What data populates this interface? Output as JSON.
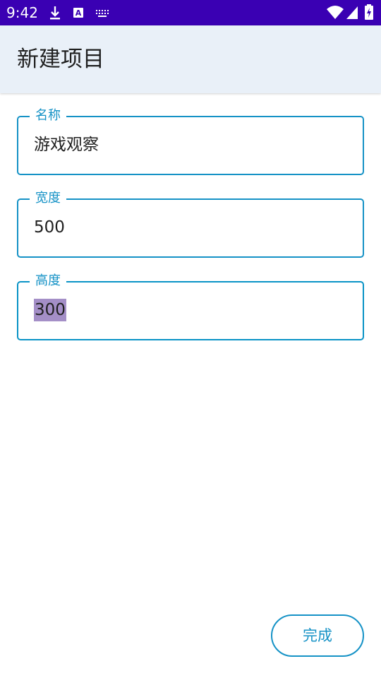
{
  "status_bar": {
    "time": "9:42",
    "left_icons": [
      "download-icon",
      "text-a-icon",
      "keyboard-icon"
    ],
    "right_icons": [
      "wifi-icon",
      "signal-icon",
      "battery-charging-icon"
    ]
  },
  "app_bar": {
    "title": "新建项目"
  },
  "form": {
    "fields": [
      {
        "label": "名称",
        "value": "游戏观察"
      },
      {
        "label": "宽度",
        "value": "500"
      },
      {
        "label": "高度",
        "value": "300"
      }
    ]
  },
  "actions": {
    "done_label": "完成"
  },
  "colors": {
    "status_bar": "#3a00b3",
    "app_bar": "#e9f0f8",
    "accent": "#1592c6",
    "selection": "#a48fc7"
  }
}
